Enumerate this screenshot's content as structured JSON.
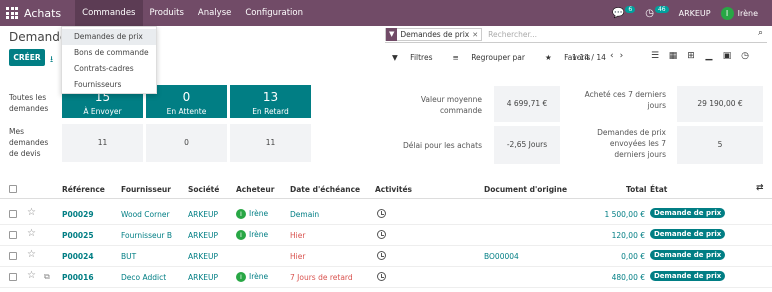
{
  "navbar": {
    "brand": "Achats",
    "menus": [
      "Commandes",
      "Produits",
      "Analyse",
      "Configuration"
    ],
    "chat_count": "6",
    "activity_count": "46",
    "company": "ARKEUP",
    "user_initial": "I",
    "user_name": "Irène"
  },
  "dropdown": {
    "items": [
      "Demandes de prix",
      "Bons de commande",
      "Contrats-cadres",
      "Fournisseurs"
    ]
  },
  "control": {
    "title": "Demandes",
    "create_label": "CRÉER",
    "search_facet": "Demandes de prix",
    "search_placeholder": "Rechercher...",
    "filters_label": "Filtres",
    "group_label": "Regrouper par",
    "favorites_label": "Favoris",
    "pager": "1-14 / 14"
  },
  "dashboard": {
    "row1_label": "Toutes les demandes",
    "row2_label": "Mes demandes de devis",
    "tiles": [
      {
        "count": "15",
        "label": "À Envoyer"
      },
      {
        "count": "0",
        "label": "En Attente"
      },
      {
        "count": "13",
        "label": "En Retard"
      }
    ],
    "my_counts": [
      "11",
      "0",
      "11"
    ],
    "kpis": [
      {
        "label": "Valeur moyenne commande",
        "value": "4 699,71 €"
      },
      {
        "label": "Acheté ces 7 derniers jours",
        "value": "29 190,00 €"
      },
      {
        "label": "Délai pour les achats",
        "value": "-2,65 Jours"
      },
      {
        "label": "Demandes de prix envoyées les 7 derniers jours",
        "value": "5"
      }
    ]
  },
  "table": {
    "headers": {
      "reference": "Référence",
      "supplier": "Fournisseur",
      "company": "Société",
      "buyer": "Acheteur",
      "deadline": "Date d'échéance",
      "activities": "Activités",
      "origin": "Document d'origine",
      "total": "Total",
      "state": "État"
    },
    "rows": [
      {
        "ref": "P00029",
        "supplier": "Wood Corner",
        "company": "ARKEUP",
        "buyer": "Irène",
        "deadline": "Demain",
        "origin": "",
        "total": "1 500,00 €",
        "state": "Demande de prix"
      },
      {
        "ref": "P00025",
        "supplier": "Fournisseur B",
        "company": "ARKEUP",
        "buyer": "Irène",
        "deadline": "Hier",
        "origin": "",
        "total": "120,00 €",
        "state": "Demande de prix"
      },
      {
        "ref": "P00024",
        "supplier": "BUT",
        "company": "ARKEUP",
        "buyer": "",
        "deadline": "Hier",
        "origin": "BO00004",
        "total": "0,00 €",
        "state": "Demande de prix"
      },
      {
        "ref": "P00016",
        "supplier": "Deco Addict",
        "company": "ARKEUP",
        "buyer": "Irène",
        "deadline": "7 Jours de retard",
        "origin": "",
        "total": "480,00 €",
        "state": "Demande de prix"
      }
    ]
  }
}
